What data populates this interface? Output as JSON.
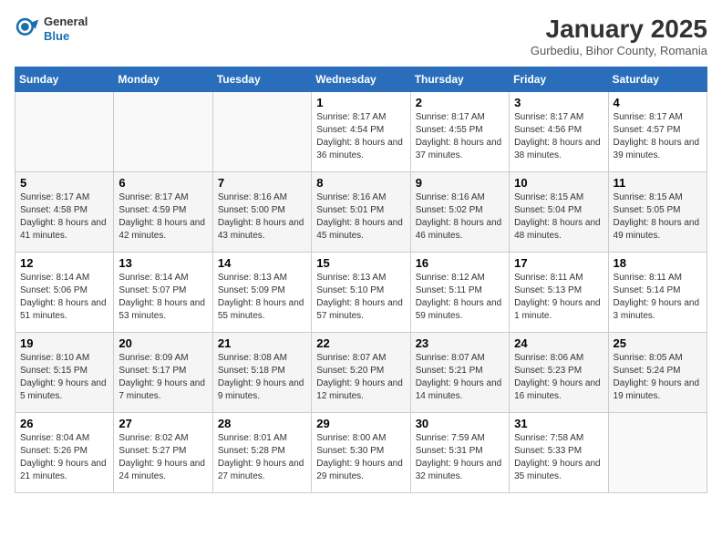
{
  "logo": {
    "general": "General",
    "blue": "Blue"
  },
  "header": {
    "title": "January 2025",
    "subtitle": "Gurbediu, Bihor County, Romania"
  },
  "weekdays": [
    "Sunday",
    "Monday",
    "Tuesday",
    "Wednesday",
    "Thursday",
    "Friday",
    "Saturday"
  ],
  "weeks": [
    [
      {
        "day": "",
        "info": ""
      },
      {
        "day": "",
        "info": ""
      },
      {
        "day": "",
        "info": ""
      },
      {
        "day": "1",
        "info": "Sunrise: 8:17 AM\nSunset: 4:54 PM\nDaylight: 8 hours and 36 minutes."
      },
      {
        "day": "2",
        "info": "Sunrise: 8:17 AM\nSunset: 4:55 PM\nDaylight: 8 hours and 37 minutes."
      },
      {
        "day": "3",
        "info": "Sunrise: 8:17 AM\nSunset: 4:56 PM\nDaylight: 8 hours and 38 minutes."
      },
      {
        "day": "4",
        "info": "Sunrise: 8:17 AM\nSunset: 4:57 PM\nDaylight: 8 hours and 39 minutes."
      }
    ],
    [
      {
        "day": "5",
        "info": "Sunrise: 8:17 AM\nSunset: 4:58 PM\nDaylight: 8 hours and 41 minutes."
      },
      {
        "day": "6",
        "info": "Sunrise: 8:17 AM\nSunset: 4:59 PM\nDaylight: 8 hours and 42 minutes."
      },
      {
        "day": "7",
        "info": "Sunrise: 8:16 AM\nSunset: 5:00 PM\nDaylight: 8 hours and 43 minutes."
      },
      {
        "day": "8",
        "info": "Sunrise: 8:16 AM\nSunset: 5:01 PM\nDaylight: 8 hours and 45 minutes."
      },
      {
        "day": "9",
        "info": "Sunrise: 8:16 AM\nSunset: 5:02 PM\nDaylight: 8 hours and 46 minutes."
      },
      {
        "day": "10",
        "info": "Sunrise: 8:15 AM\nSunset: 5:04 PM\nDaylight: 8 hours and 48 minutes."
      },
      {
        "day": "11",
        "info": "Sunrise: 8:15 AM\nSunset: 5:05 PM\nDaylight: 8 hours and 49 minutes."
      }
    ],
    [
      {
        "day": "12",
        "info": "Sunrise: 8:14 AM\nSunset: 5:06 PM\nDaylight: 8 hours and 51 minutes."
      },
      {
        "day": "13",
        "info": "Sunrise: 8:14 AM\nSunset: 5:07 PM\nDaylight: 8 hours and 53 minutes."
      },
      {
        "day": "14",
        "info": "Sunrise: 8:13 AM\nSunset: 5:09 PM\nDaylight: 8 hours and 55 minutes."
      },
      {
        "day": "15",
        "info": "Sunrise: 8:13 AM\nSunset: 5:10 PM\nDaylight: 8 hours and 57 minutes."
      },
      {
        "day": "16",
        "info": "Sunrise: 8:12 AM\nSunset: 5:11 PM\nDaylight: 8 hours and 59 minutes."
      },
      {
        "day": "17",
        "info": "Sunrise: 8:11 AM\nSunset: 5:13 PM\nDaylight: 9 hours and 1 minute."
      },
      {
        "day": "18",
        "info": "Sunrise: 8:11 AM\nSunset: 5:14 PM\nDaylight: 9 hours and 3 minutes."
      }
    ],
    [
      {
        "day": "19",
        "info": "Sunrise: 8:10 AM\nSunset: 5:15 PM\nDaylight: 9 hours and 5 minutes."
      },
      {
        "day": "20",
        "info": "Sunrise: 8:09 AM\nSunset: 5:17 PM\nDaylight: 9 hours and 7 minutes."
      },
      {
        "day": "21",
        "info": "Sunrise: 8:08 AM\nSunset: 5:18 PM\nDaylight: 9 hours and 9 minutes."
      },
      {
        "day": "22",
        "info": "Sunrise: 8:07 AM\nSunset: 5:20 PM\nDaylight: 9 hours and 12 minutes."
      },
      {
        "day": "23",
        "info": "Sunrise: 8:07 AM\nSunset: 5:21 PM\nDaylight: 9 hours and 14 minutes."
      },
      {
        "day": "24",
        "info": "Sunrise: 8:06 AM\nSunset: 5:23 PM\nDaylight: 9 hours and 16 minutes."
      },
      {
        "day": "25",
        "info": "Sunrise: 8:05 AM\nSunset: 5:24 PM\nDaylight: 9 hours and 19 minutes."
      }
    ],
    [
      {
        "day": "26",
        "info": "Sunrise: 8:04 AM\nSunset: 5:26 PM\nDaylight: 9 hours and 21 minutes."
      },
      {
        "day": "27",
        "info": "Sunrise: 8:02 AM\nSunset: 5:27 PM\nDaylight: 9 hours and 24 minutes."
      },
      {
        "day": "28",
        "info": "Sunrise: 8:01 AM\nSunset: 5:28 PM\nDaylight: 9 hours and 27 minutes."
      },
      {
        "day": "29",
        "info": "Sunrise: 8:00 AM\nSunset: 5:30 PM\nDaylight: 9 hours and 29 minutes."
      },
      {
        "day": "30",
        "info": "Sunrise: 7:59 AM\nSunset: 5:31 PM\nDaylight: 9 hours and 32 minutes."
      },
      {
        "day": "31",
        "info": "Sunrise: 7:58 AM\nSunset: 5:33 PM\nDaylight: 9 hours and 35 minutes."
      },
      {
        "day": "",
        "info": ""
      }
    ]
  ]
}
